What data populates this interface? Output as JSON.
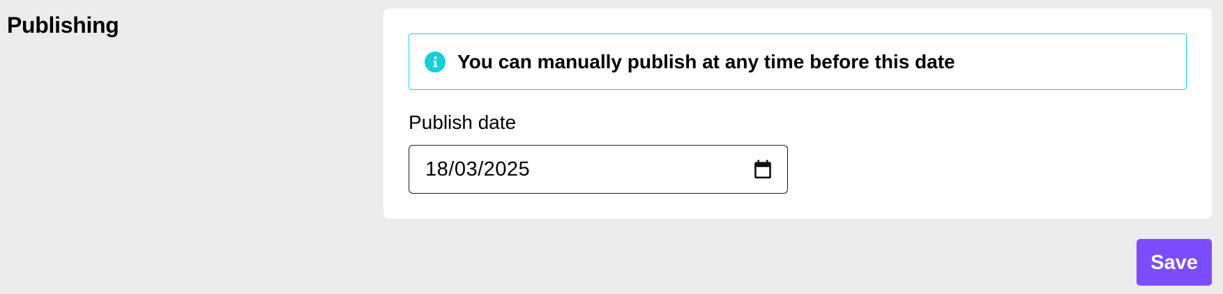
{
  "section": {
    "title": "Publishing"
  },
  "notice": {
    "icon": "info-circle-icon",
    "text": "You can manually publish at any time before this date",
    "accent_color": "#12cfd8"
  },
  "publish_date": {
    "label": "Publish date",
    "value": "18/03/2025",
    "icon": "calendar-icon"
  },
  "actions": {
    "save_label": "Save",
    "save_color": "#7c4dff"
  }
}
